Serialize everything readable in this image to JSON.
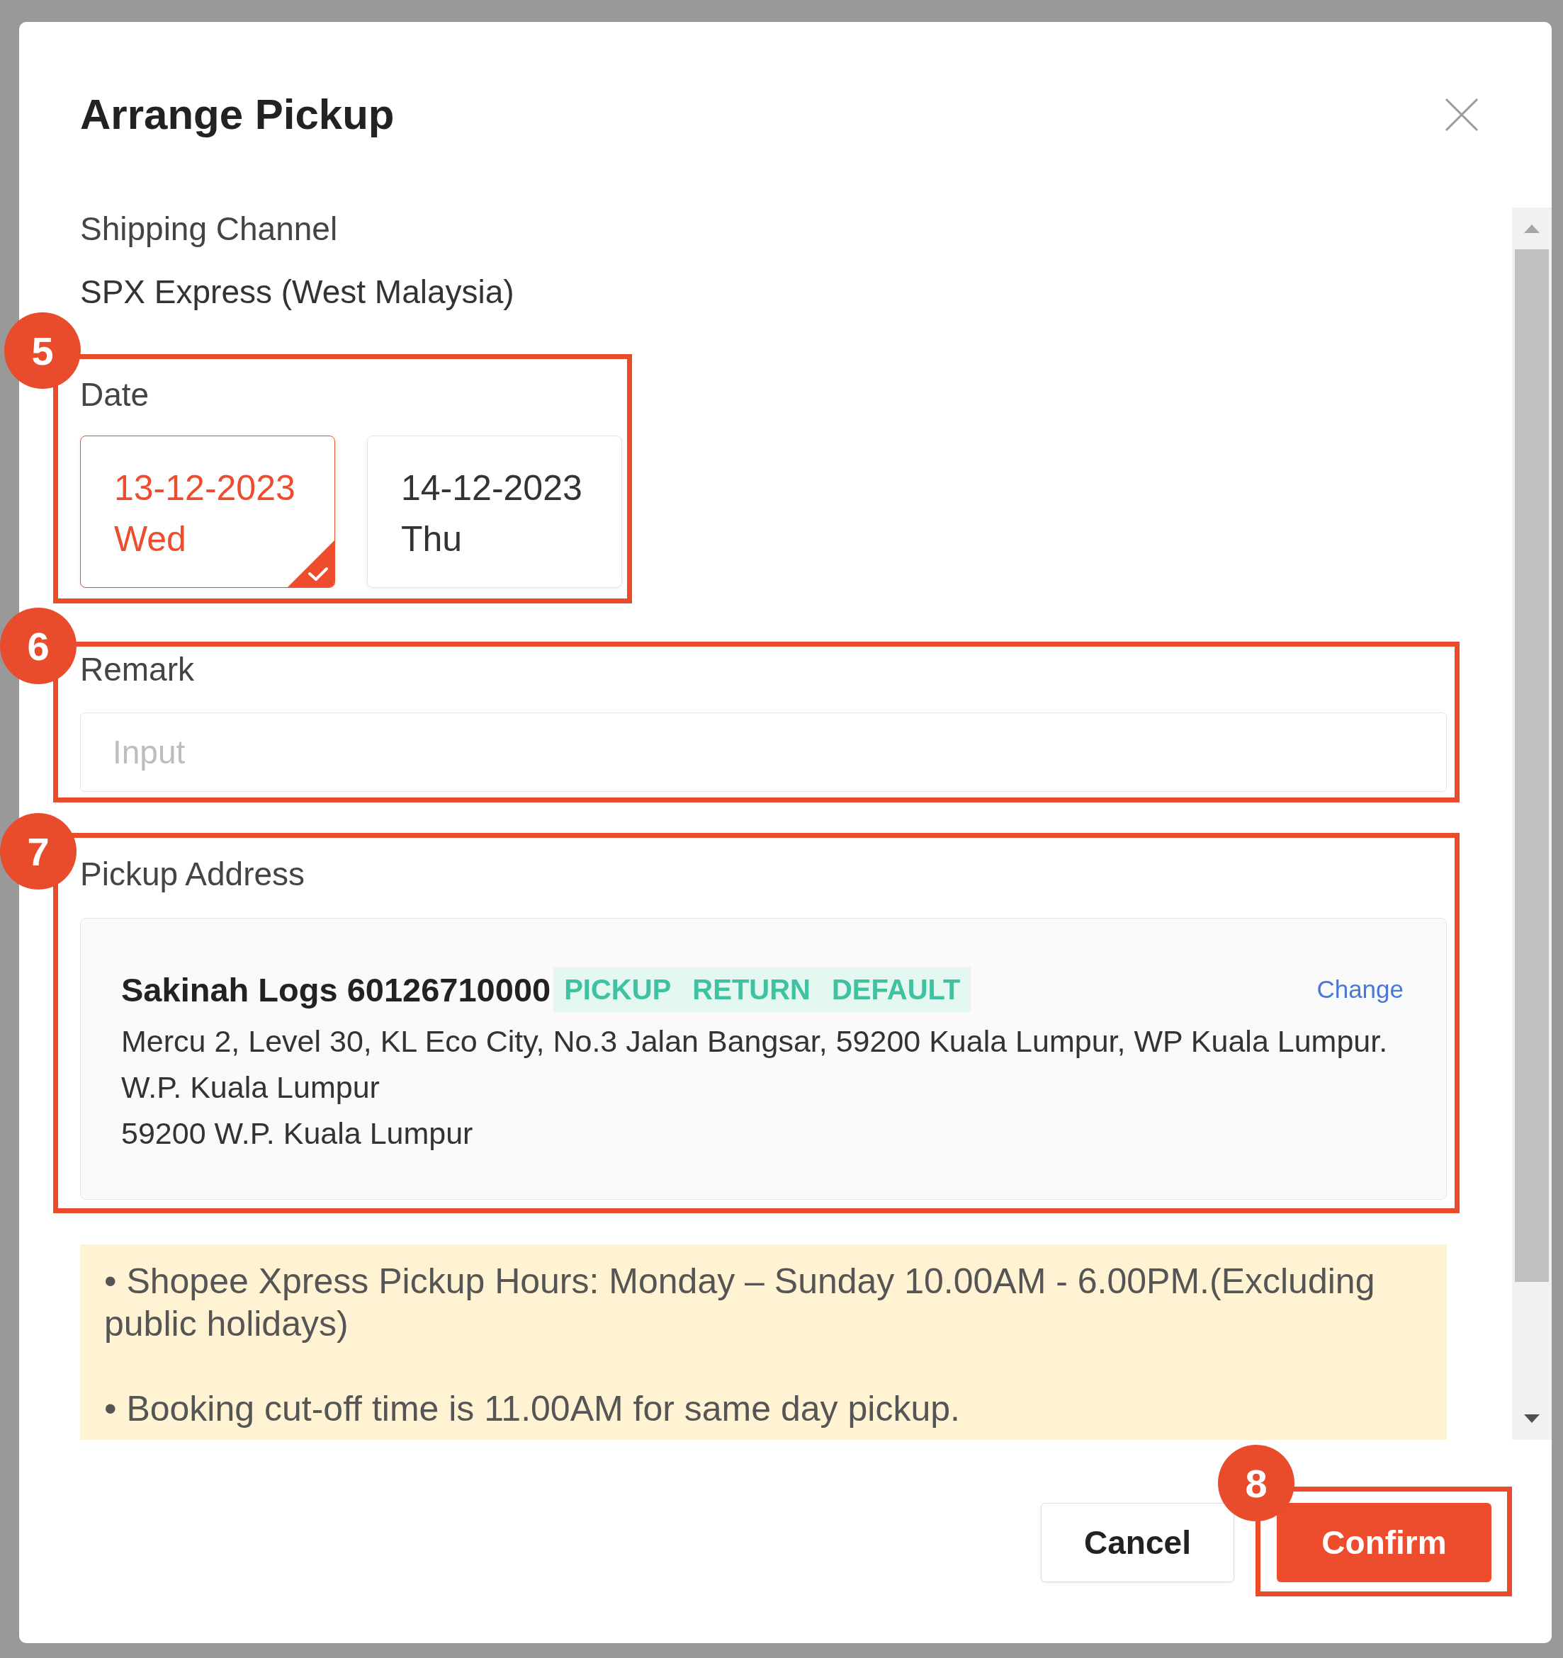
{
  "window": {
    "title": "Arrange Pickup"
  },
  "shipping_channel": {
    "label": "Shipping Channel",
    "value": "SPX Express (West Malaysia)"
  },
  "date": {
    "marker": "5",
    "label": "Date",
    "options": [
      {
        "date": "13-12-2023",
        "day": "Wed",
        "selected": true
      },
      {
        "date": "14-12-2023",
        "day": "Thu",
        "selected": false
      }
    ]
  },
  "remark": {
    "marker": "6",
    "label": "Remark",
    "placeholder": "Input"
  },
  "pickup_address": {
    "marker": "7",
    "label": "Pickup Address",
    "name": "Sakinah Logs 60126710000",
    "tags": [
      "PICKUP",
      "RETURN",
      "DEFAULT"
    ],
    "action": "Change",
    "lines": [
      "Mercu 2, Level 30, KL Eco City, No.3 Jalan Bangsar, 59200 Kuala Lumpur, WP Kuala Lumpur.",
      "W.P. Kuala Lumpur",
      "59200 W.P. Kuala Lumpur"
    ]
  },
  "notice": {
    "lines": [
      "• Shopee Xpress Pickup Hours: Monday – Sunday 10.00AM - 6.00PM.(Excluding public holidays)",
      "• Booking cut-off time is 11.00AM for same day pickup."
    ]
  },
  "footer": {
    "buttons": [
      {
        "label": "Cancel",
        "kind": "secondary"
      },
      {
        "label": "Confirm",
        "kind": "primary",
        "marker": "8"
      }
    ]
  }
}
